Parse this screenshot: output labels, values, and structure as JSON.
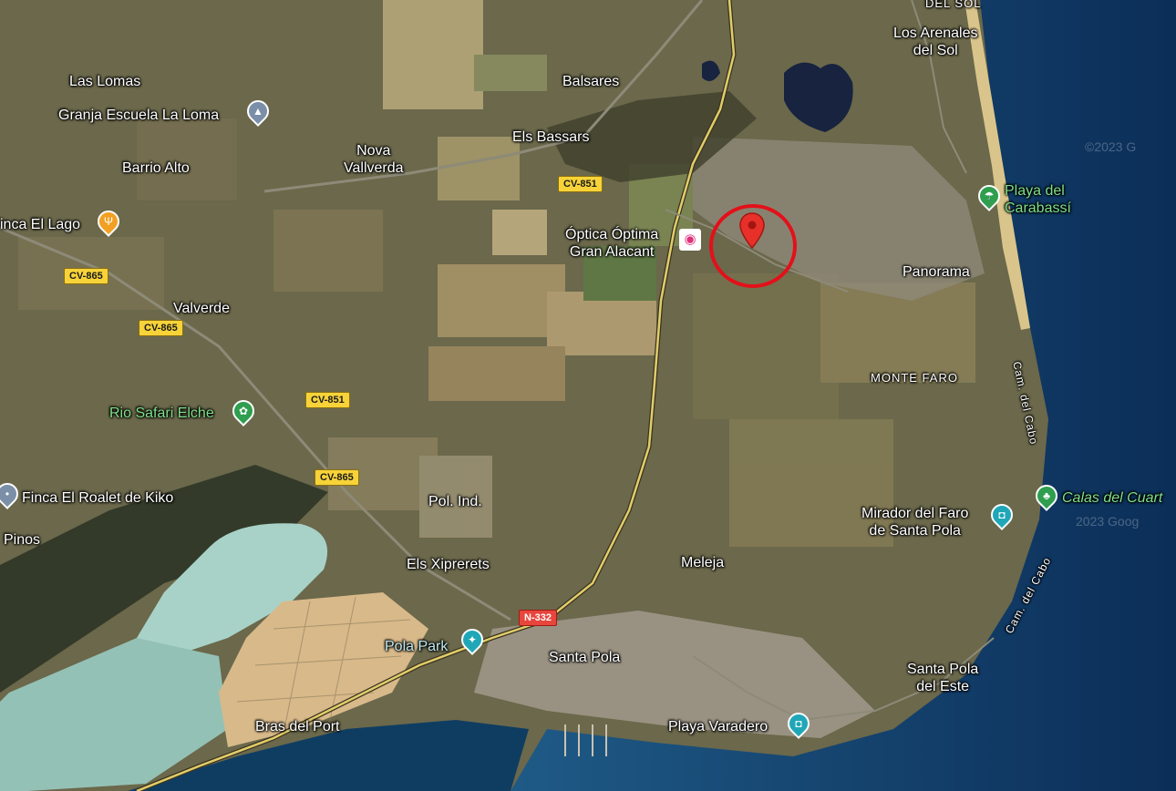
{
  "map": {
    "colors": {
      "land": "#6e6a4c",
      "field": "#a08f66",
      "sea": "#0d3a6b",
      "lagoon": "#9cc7c0",
      "road": "#d8c46a",
      "highlight": "#e3101a"
    },
    "places": {
      "los_arenales_del_sol": "Los Arenales\ndel Sol",
      "del_sol_top": "DEL SOL",
      "las_lomas": "Las Lomas",
      "granja_escuela": "Granja Escuela La Loma",
      "balsares": "Balsares",
      "nova_vallverda": "Nova\nVallverda",
      "els_bassars": "Els Bassars",
      "barrio_alto": "Barrio Alto",
      "finca_el_lago": "inca El Lago",
      "playa_del_carabassi": "Playa del\nCarabassí",
      "optica": "Óptica Óptima\nGran Alacant",
      "panorama": "Panorama",
      "valverde": "Valverde",
      "monte_faro": "MONTE FARO",
      "cami_del_cabo_1": "Cam. del Cabo",
      "rio_safari": "Rio Safari Elche",
      "finca_el_roalet": "Finca El Roalet de Kiko",
      "calas_del_cuarto": "Calas del Cuart",
      "pol_ind": "Pol. Ind.",
      "mirador": "Mirador del Faro\nde Santa Pola",
      "pinos": "Pinos",
      "els_xiprerets": "Els Xiprerets",
      "meleja": "Meleja",
      "cami_del_cabo_2": "Cam. del Cabo",
      "pola_park": "Pola Park",
      "santa_pola": "Santa Pola",
      "santa_pola_del_este": "Santa Pola\ndel Este",
      "bras_del_port": "Bras del Port",
      "playa_varadero": "Playa Varadero"
    },
    "road_shields": {
      "cv851_a": "CV-851",
      "cv865_a": "CV-865",
      "cv865_b": "CV-865",
      "cv851_b": "CV-851",
      "cv865_c": "CV-865",
      "n332": "N-332"
    },
    "watermarks": {
      "copyright_1": "©2023 G",
      "copyright_2": "2023 Goog"
    },
    "icons": {
      "granja_escuela": "school-icon",
      "finca_el_lago": "restaurant-icon",
      "playa_del_carabassi": "beach-icon",
      "optica": "shop-icon",
      "rio_safari": "paw-icon",
      "finca_el_roalet": "place-icon",
      "calas_del_cuarto": "park-icon",
      "mirador": "camera-icon",
      "pola_park": "amusement-park-icon",
      "playa_varadero": "camera-icon",
      "location": "red-location-pin-icon"
    }
  }
}
